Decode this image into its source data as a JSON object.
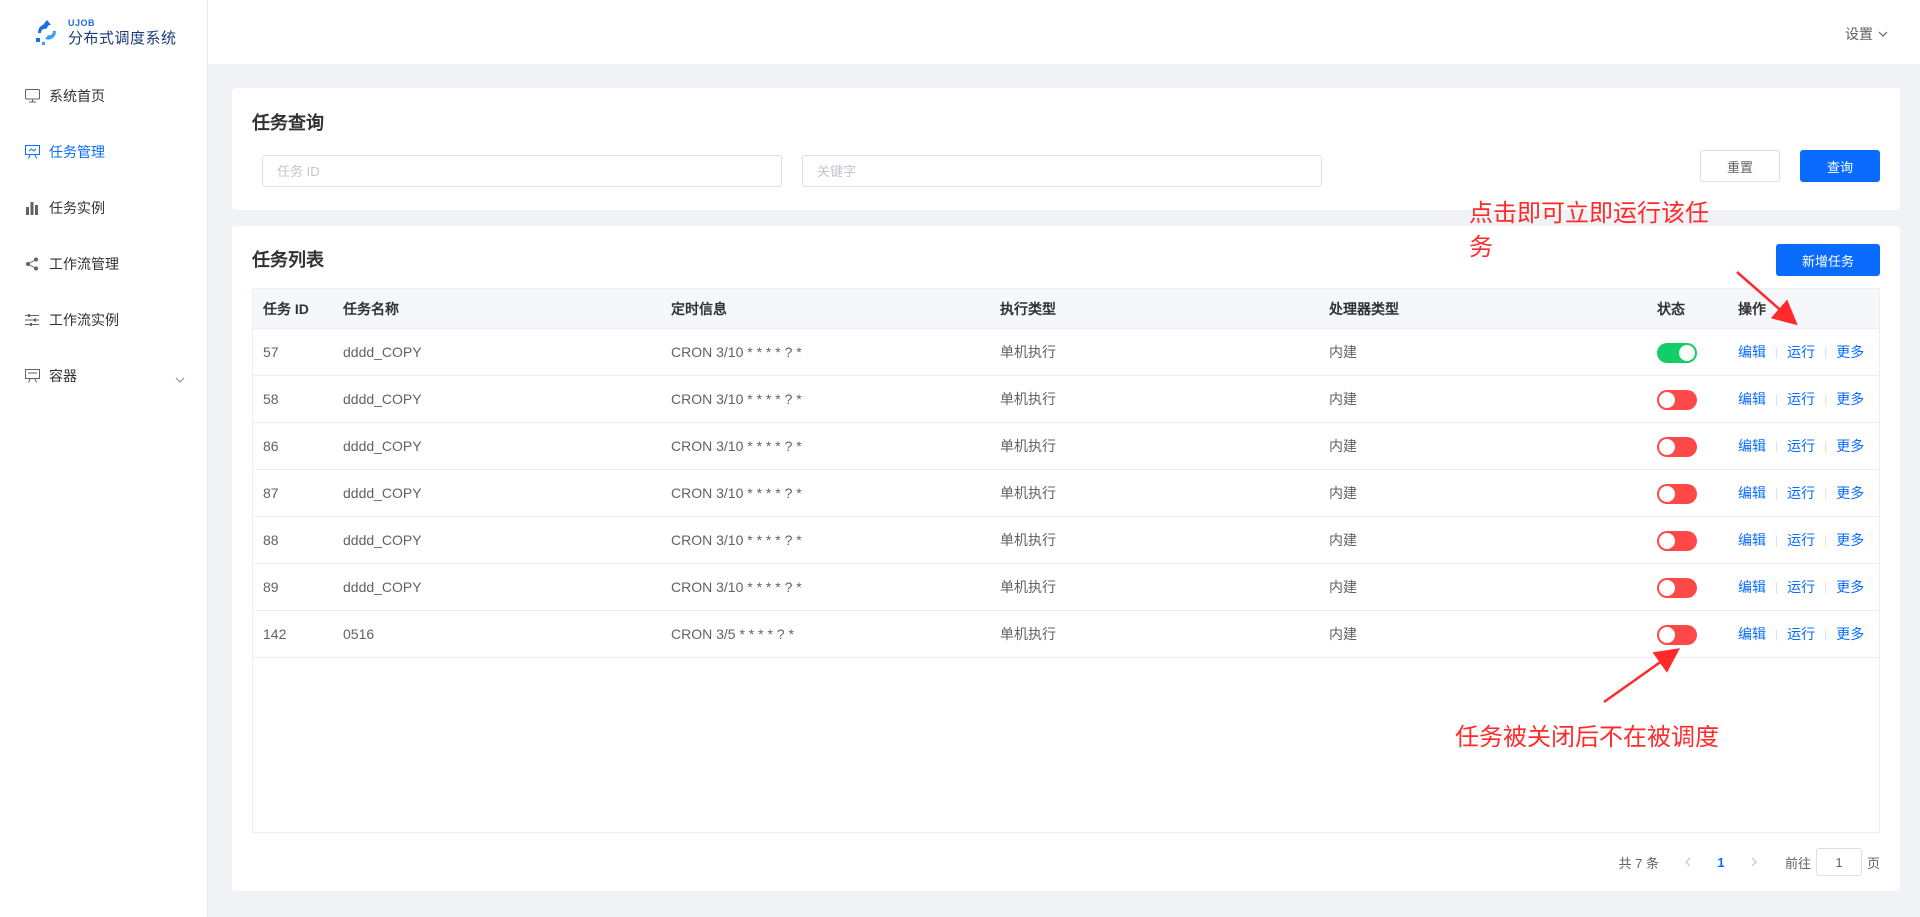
{
  "logo": {
    "small_text": "UJOB",
    "big_text": "分布式调度系统"
  },
  "sidebar": {
    "items": [
      {
        "label": "系统首页",
        "icon": "monitor-icon"
      },
      {
        "label": "任务管理",
        "icon": "board-icon",
        "active": true
      },
      {
        "label": "任务实例",
        "icon": "bar-chart-icon"
      },
      {
        "label": "工作流管理",
        "icon": "share-icon"
      },
      {
        "label": "工作流实例",
        "icon": "sliders-icon"
      },
      {
        "label": "容器",
        "icon": "container-icon",
        "has_submenu": true
      }
    ]
  },
  "header": {
    "settings_label": "设置"
  },
  "query": {
    "title": "任务查询",
    "id_placeholder": "任务 ID",
    "keyword_placeholder": "关键字",
    "reset_label": "重置",
    "search_label": "查询"
  },
  "list": {
    "title": "任务列表",
    "new_label": "新增任务",
    "columns": [
      "任务 ID",
      "任务名称",
      "定时信息",
      "执行类型",
      "处理器类型",
      "状态",
      "操作"
    ],
    "ops": {
      "edit": "编辑",
      "run": "运行",
      "more": "更多"
    },
    "rows": [
      {
        "id": "57",
        "name": "dddd_COPY",
        "cron": "CRON 3/10 * * * * ? *",
        "exec": "单机执行",
        "proc": "内建",
        "enabled": true
      },
      {
        "id": "58",
        "name": "dddd_COPY",
        "cron": "CRON 3/10 * * * * ? *",
        "exec": "单机执行",
        "proc": "内建",
        "enabled": false
      },
      {
        "id": "86",
        "name": "dddd_COPY",
        "cron": "CRON 3/10 * * * * ? *",
        "exec": "单机执行",
        "proc": "内建",
        "enabled": false
      },
      {
        "id": "87",
        "name": "dddd_COPY",
        "cron": "CRON 3/10 * * * * ? *",
        "exec": "单机执行",
        "proc": "内建",
        "enabled": false
      },
      {
        "id": "88",
        "name": "dddd_COPY",
        "cron": "CRON 3/10 * * * * ? *",
        "exec": "单机执行",
        "proc": "内建",
        "enabled": false
      },
      {
        "id": "89",
        "name": "dddd_COPY",
        "cron": "CRON 3/10 * * * * ? *",
        "exec": "单机执行",
        "proc": "内建",
        "enabled": false
      },
      {
        "id": "142",
        "name": "0516",
        "cron": "CRON 3/5 * * * * ? *",
        "exec": "单机执行",
        "proc": "内建",
        "enabled": false
      }
    ]
  },
  "pagination": {
    "total_text": "共 7 条",
    "current_page": "1",
    "goto_prefix": "前往",
    "goto_value": "1",
    "goto_suffix": "页"
  },
  "annotations": {
    "run_note": "点击即可立即运行该任务",
    "run_note_line1": "点击即可立即运行该任",
    "run_note_line2": "务",
    "closed_note": "任务被关闭后不在被调度",
    "color": "#ff2a2a"
  },
  "colors": {
    "primary": "#0a6cff",
    "switch_on": "#13ce66",
    "switch_off": "#ff4949"
  }
}
